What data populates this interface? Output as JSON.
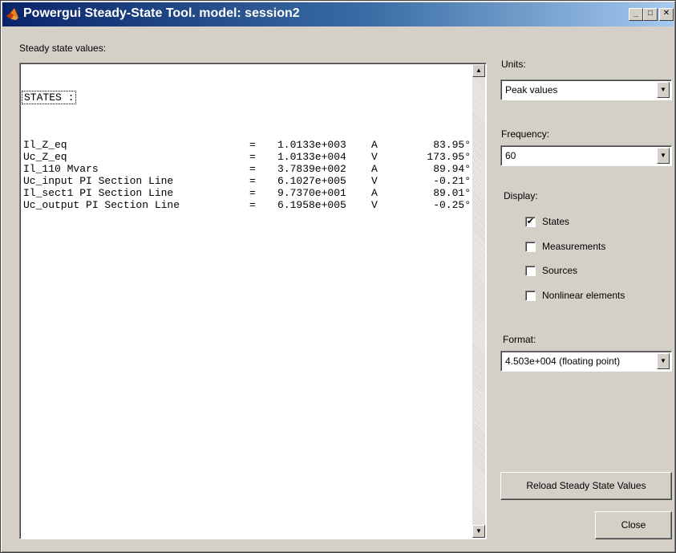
{
  "window": {
    "title": "Powergui Steady-State Tool. model: session2",
    "controls": {
      "minimize": "_",
      "maximize": "□",
      "close": "✕"
    }
  },
  "main": {
    "label": "Steady state values:",
    "header": "STATES :",
    "states": [
      {
        "name": "Il_Z_eq",
        "eq": "=",
        "value": "1.0133e+003",
        "unit": "A",
        "angle": "83.95°"
      },
      {
        "name": "Uc_Z_eq",
        "eq": "=",
        "value": "1.0133e+004",
        "unit": "V",
        "angle": "173.95°"
      },
      {
        "name": "Il_110 Mvars",
        "eq": "=",
        "value": "3.7839e+002",
        "unit": "A",
        "angle": "89.94°"
      },
      {
        "name": "Uc_input PI Section Line",
        "eq": "=",
        "value": "6.1027e+005",
        "unit": "V",
        "angle": "-0.21°"
      },
      {
        "name": "Il_sect1 PI Section Line",
        "eq": "=",
        "value": "9.7370e+001",
        "unit": "A",
        "angle": "89.01°"
      },
      {
        "name": "Uc_output PI Section Line",
        "eq": "=",
        "value": "6.1958e+005",
        "unit": "V",
        "angle": "-0.25°"
      }
    ]
  },
  "side": {
    "units_label": "Units:",
    "units_value": "Peak values",
    "frequency_label": "Frequency:",
    "frequency_value": "60",
    "display_label": "Display:",
    "checkboxes": [
      {
        "label": "States",
        "checked": true
      },
      {
        "label": "Measurements",
        "checked": false
      },
      {
        "label": "Sources",
        "checked": false
      },
      {
        "label": "Nonlinear elements",
        "checked": false
      }
    ],
    "format_label": "Format:",
    "format_value": "4.503e+004 (floating point)",
    "reload_button": "Reload Steady State Values",
    "close_button": "Close"
  },
  "icons": {
    "app": "matlab-logo-icon",
    "dropdown_arrow": "▼",
    "scroll_up": "▲",
    "scroll_down": "▼",
    "check": "✔"
  },
  "colors": {
    "titlebar_start": "#0a246a",
    "titlebar_end": "#a6caf0",
    "face": "#d4d0c8"
  }
}
